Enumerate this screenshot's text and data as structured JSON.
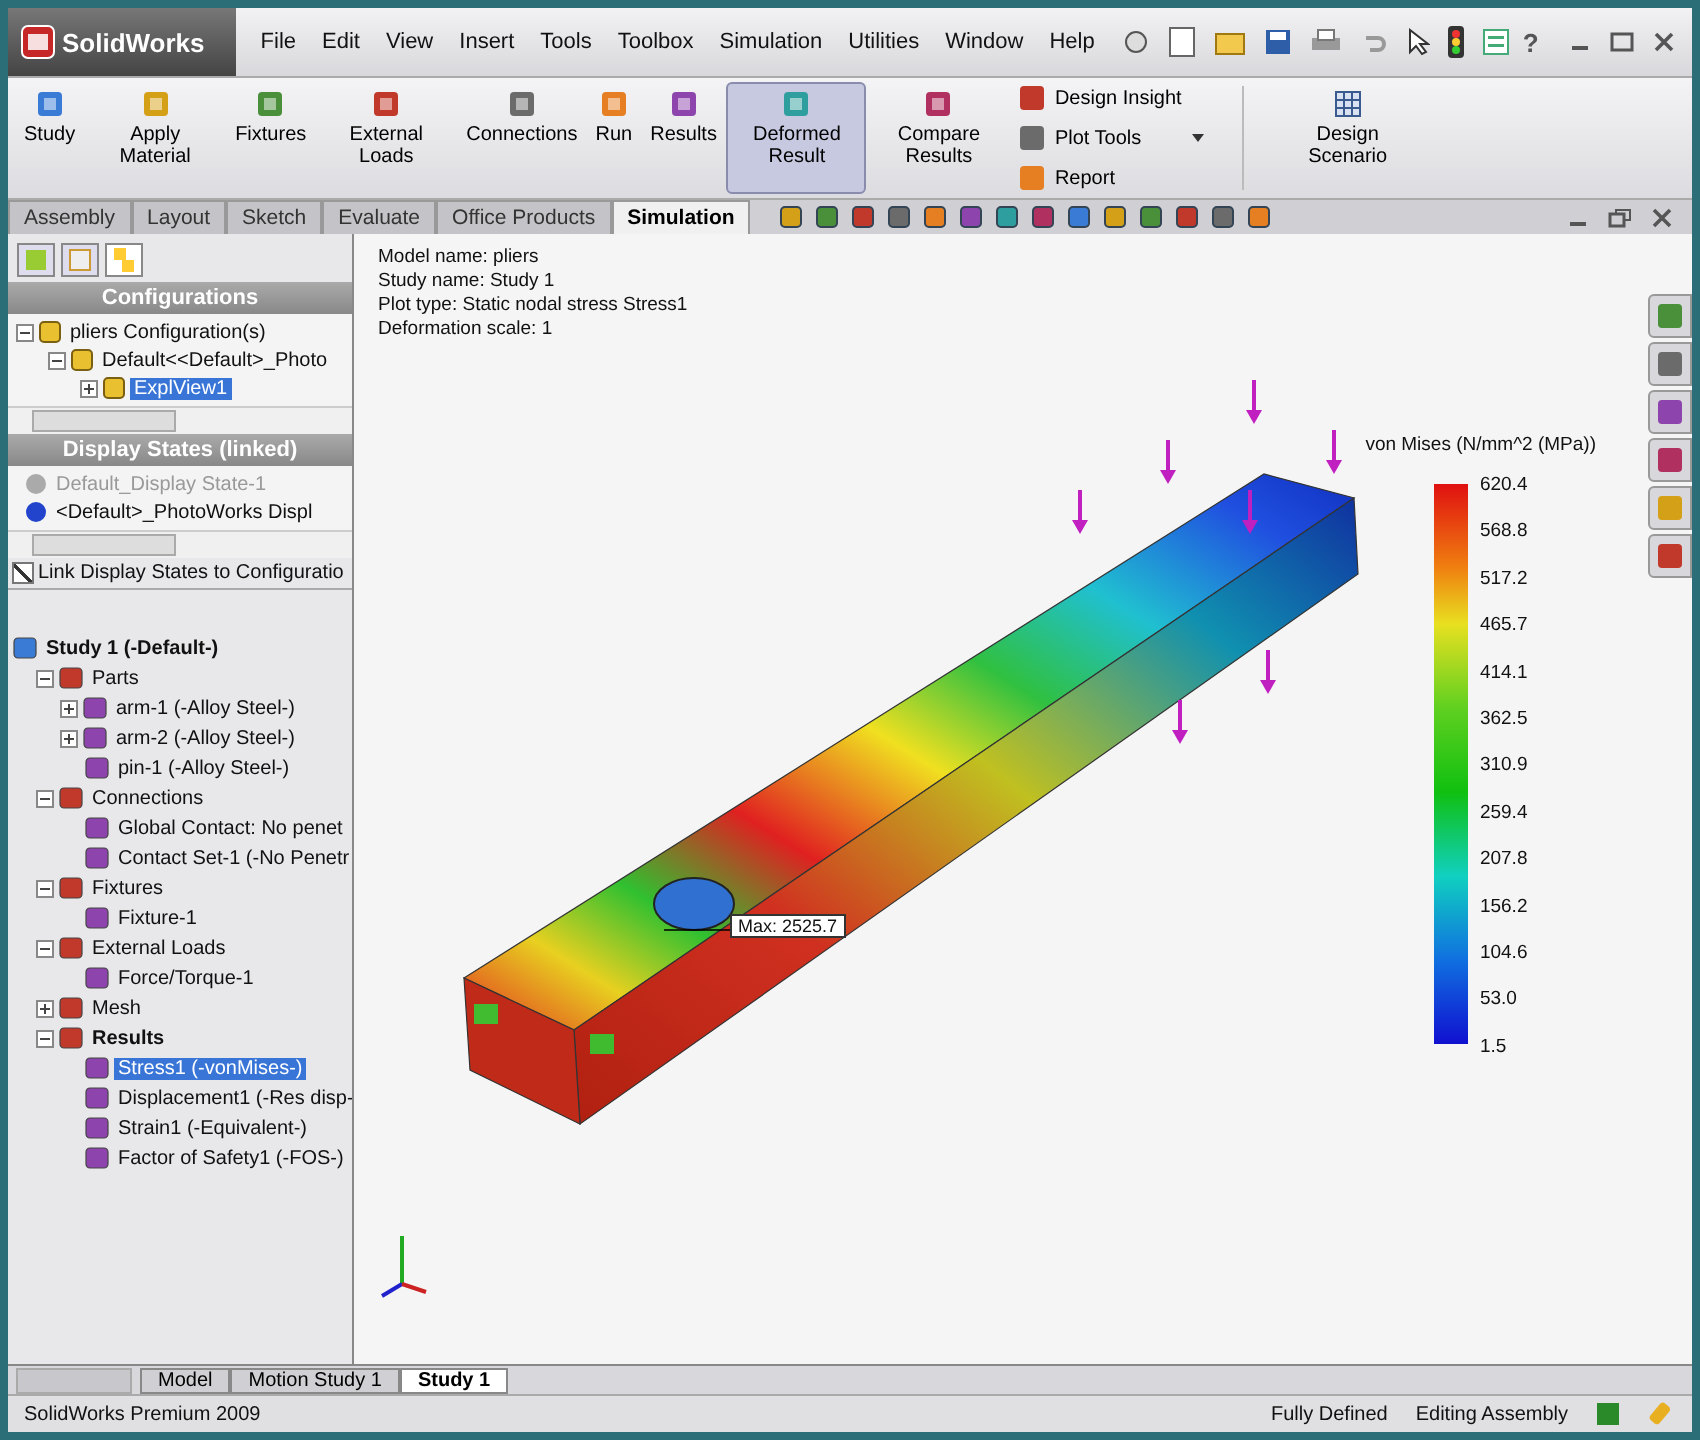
{
  "app": {
    "logo": "SolidWorks",
    "help_glyph": "?"
  },
  "menu": [
    "File",
    "Edit",
    "View",
    "Insert",
    "Tools",
    "Toolbox",
    "Simulation",
    "Utilities",
    "Window",
    "Help"
  ],
  "ribbon": {
    "buttons": [
      {
        "label": "Study",
        "selected": false
      },
      {
        "label": "Apply Material",
        "selected": false
      },
      {
        "label": "Fixtures",
        "selected": false
      },
      {
        "label": "External Loads",
        "selected": false
      },
      {
        "label": "Connections",
        "selected": false
      },
      {
        "label": "Run",
        "selected": false
      },
      {
        "label": "Results",
        "selected": false
      },
      {
        "label": "Deformed Result",
        "selected": true
      },
      {
        "label": "Compare Results",
        "selected": false
      }
    ],
    "stack": [
      "Design Insight",
      "Plot Tools",
      "Report"
    ],
    "scenario": {
      "label": "Design Scenario",
      "selected": false
    }
  },
  "tabs": [
    {
      "label": "Assembly",
      "selected": false
    },
    {
      "label": "Layout",
      "selected": false
    },
    {
      "label": "Sketch",
      "selected": false
    },
    {
      "label": "Evaluate",
      "selected": false
    },
    {
      "label": "Office Products",
      "selected": false
    },
    {
      "label": "Simulation",
      "selected": true
    }
  ],
  "configurations": {
    "header": "Configurations",
    "tree": [
      {
        "label": "pliers Configuration(s)",
        "expanded": true,
        "selected": false,
        "children": [
          {
            "label": "Default<<Default>_Photo",
            "expanded": true,
            "selected": false,
            "children": [
              {
                "label": "ExplView1",
                "expanded": false,
                "selected": true
              }
            ]
          }
        ]
      }
    ]
  },
  "display_states": {
    "header": "Display States (linked)",
    "items": [
      {
        "label": "Default_Display State-1",
        "disabled": true
      },
      {
        "label": "<Default>_PhotoWorks Displ",
        "disabled": false
      }
    ],
    "link_checkbox": {
      "label": "Link Display States to Configuratio",
      "checked": true
    }
  },
  "study_tree": [
    {
      "label": "Study 1 (-Default-)",
      "bold": true,
      "selected": false,
      "children": [
        {
          "label": "Parts",
          "expanded": true,
          "selected": false,
          "children": [
            {
              "label": "arm-1 (-Alloy Steel-)",
              "expanded": false,
              "selected": false
            },
            {
              "label": "arm-2 (-Alloy Steel-)",
              "expanded": false,
              "selected": false
            },
            {
              "label": "pin-1 (-Alloy Steel-)",
              "selected": false
            }
          ]
        },
        {
          "label": "Connections",
          "expanded": true,
          "selected": false,
          "children": [
            {
              "label": "Global Contact: No penet",
              "selected": false
            },
            {
              "label": "Contact Set-1 (-No Penetr",
              "selected": false
            }
          ]
        },
        {
          "label": "Fixtures",
          "expanded": true,
          "selected": false,
          "children": [
            {
              "label": "Fixture-1",
              "selected": false
            }
          ]
        },
        {
          "label": "External Loads",
          "expanded": true,
          "selected": false,
          "children": [
            {
              "label": "Force/Torque-1",
              "selected": false
            }
          ]
        },
        {
          "label": "Mesh",
          "expanded": false,
          "selected": false
        },
        {
          "label": "Results",
          "expanded": true,
          "bold": true,
          "selected": false,
          "children": [
            {
              "label": "Stress1 (-vonMises-)",
              "selected": true
            },
            {
              "label": "Displacement1 (-Res disp-",
              "selected": false
            },
            {
              "label": "Strain1 (-Equivalent-)",
              "selected": false
            },
            {
              "label": "Factor of Safety1 (-FOS-)",
              "selected": false
            }
          ]
        }
      ]
    }
  ],
  "viewport": {
    "info": [
      "Model name: pliers",
      "Study name: Study 1",
      "Plot type: Static nodal stress Stress1",
      "Deformation scale: 1"
    ],
    "max_label": "Max: 2525.7",
    "legend": {
      "title": "von Mises (N/mm^2 (MPa))",
      "labels": [
        "620.4",
        "568.8",
        "517.2",
        "465.7",
        "414.1",
        "362.5",
        "310.9",
        "259.4",
        "207.8",
        "156.2",
        "104.6",
        "53.0",
        "1.5"
      ]
    }
  },
  "bottom_tabs": [
    {
      "label": "Model",
      "selected": false
    },
    {
      "label": "Motion Study 1",
      "selected": false
    },
    {
      "label": "Study 1",
      "selected": true
    }
  ],
  "status_bar": {
    "product": "SolidWorks Premium 2009",
    "state": "Fully Defined",
    "mode": "Editing Assembly"
  }
}
